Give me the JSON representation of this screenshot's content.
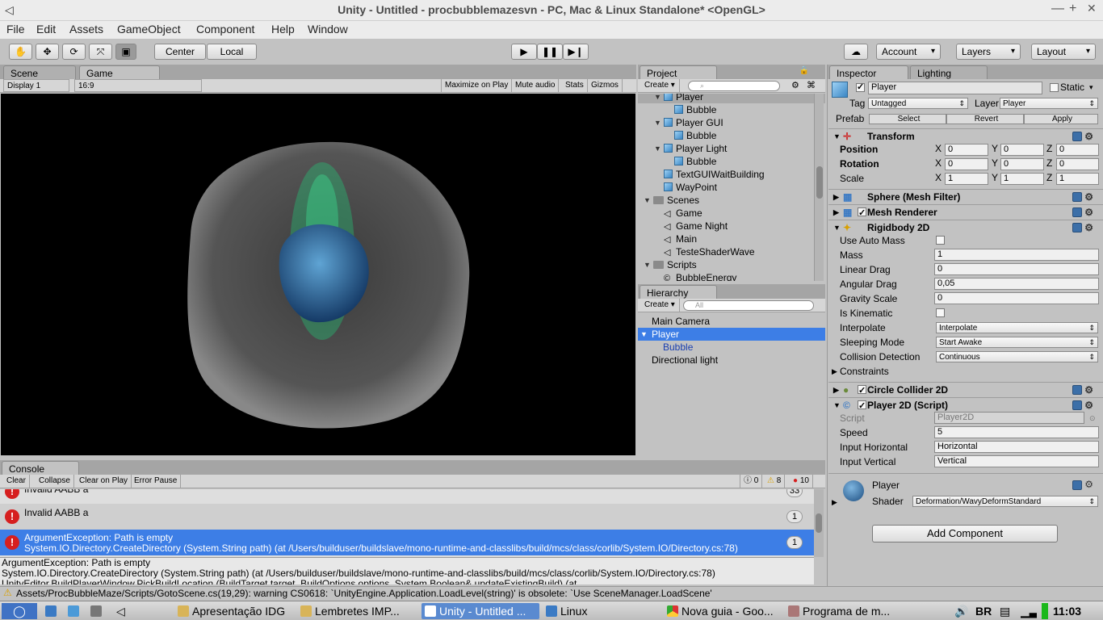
{
  "window": {
    "title": "Unity - Untitled - procbubblemazesvn - PC, Mac & Linux Standalone* <OpenGL>",
    "minimize": "—",
    "maximize": "+",
    "close": "✕"
  },
  "menu": [
    "File",
    "Edit",
    "Assets",
    "GameObject",
    "Component",
    "Help",
    "Window"
  ],
  "toolbar": {
    "pivot": "Center",
    "space": "Local",
    "account": "Account",
    "layers": "Layers",
    "layout": "Layout"
  },
  "scene_tabs": {
    "scene": "Scene",
    "game": "Game",
    "display": "Display 1",
    "aspect": "16:9",
    "maximize": "Maximize on Play",
    "mute": "Mute audio",
    "stats": "Stats",
    "gizmos": "Gizmos"
  },
  "project": {
    "tab": "Project",
    "create": "Create",
    "items": [
      {
        "label": "Player",
        "icon": "cube",
        "depth": 2,
        "expanded": true,
        "selected": true
      },
      {
        "label": "Bubble",
        "icon": "cube",
        "depth": 3
      },
      {
        "label": "Player GUI",
        "icon": "cube",
        "depth": 2,
        "expanded": true
      },
      {
        "label": "Bubble",
        "icon": "cube",
        "depth": 3
      },
      {
        "label": "Player Light",
        "icon": "cube",
        "depth": 2,
        "expanded": true
      },
      {
        "label": "Bubble",
        "icon": "cube",
        "depth": 3
      },
      {
        "label": "TextGUIWaitBuilding",
        "icon": "cube",
        "depth": 2
      },
      {
        "label": "WayPoint",
        "icon": "cube",
        "depth": 2
      },
      {
        "label": "Scenes",
        "icon": "folder",
        "depth": 1,
        "expanded": true
      },
      {
        "label": "Game",
        "icon": "unity",
        "depth": 2
      },
      {
        "label": "Game Night",
        "icon": "unity",
        "depth": 2
      },
      {
        "label": "Main",
        "icon": "unity",
        "depth": 2
      },
      {
        "label": "TesteShaderWave",
        "icon": "unity",
        "depth": 2
      },
      {
        "label": "Scripts",
        "icon": "folder",
        "depth": 1,
        "expanded": true
      },
      {
        "label": "BubbleEnergy",
        "icon": "script",
        "depth": 2
      }
    ]
  },
  "hierarchy": {
    "tab": "Hierarchy",
    "create": "Create",
    "search": "All",
    "items": [
      {
        "label": "Main Camera",
        "depth": 0
      },
      {
        "label": "Player",
        "depth": 0,
        "selected": true,
        "expanded": true
      },
      {
        "label": "Bubble",
        "depth": 1
      },
      {
        "label": "Directional light",
        "depth": 0
      }
    ]
  },
  "inspector": {
    "tab": "Inspector",
    "lighting": "Lighting",
    "name": "Player",
    "static": "Static",
    "tag_label": "Tag",
    "tag": "Untagged",
    "layer_label": "Layer",
    "layer": "Player",
    "prefab": "Prefab",
    "select": "Select",
    "revert": "Revert",
    "apply": "Apply",
    "transform": {
      "title": "Transform",
      "position": "Position",
      "rotation": "Rotation",
      "scale": "Scale",
      "pos": [
        "0",
        "0",
        "0"
      ],
      "rot": [
        "0",
        "0",
        "0"
      ],
      "scl": [
        "1",
        "1",
        "1"
      ]
    },
    "mesh_filter": "Sphere (Mesh Filter)",
    "mesh_renderer": "Mesh Renderer",
    "rigidbody": {
      "title": "Rigidbody 2D",
      "use_auto_mass": "Use Auto Mass",
      "mass_label": "Mass",
      "mass": "1",
      "linear_drag_label": "Linear Drag",
      "linear_drag": "0",
      "angular_drag_label": "Angular Drag",
      "angular_drag": "0,05",
      "gravity_label": "Gravity Scale",
      "gravity": "0",
      "kinematic": "Is Kinematic",
      "interpolate_label": "Interpolate",
      "interpolate": "Interpolate",
      "sleeping_label": "Sleeping Mode",
      "sleeping": "Start Awake",
      "collision_label": "Collision Detection",
      "collision": "Continuous",
      "constraints": "Constraints"
    },
    "circle": "Circle Collider 2D",
    "script": {
      "title": "Player 2D (Script)",
      "script_label": "Script",
      "script": "Player2D",
      "speed_label": "Speed",
      "speed": "5",
      "h_label": "Input Horizontal",
      "h": "Horizontal",
      "v_label": "Input Vertical",
      "v": "Vertical"
    },
    "material": {
      "name": "Player",
      "shader_label": "Shader",
      "shader": "Deformation/WavyDeformStandard"
    },
    "add_component": "Add Component"
  },
  "console": {
    "tab": "Console",
    "clear": "Clear",
    "collapse": "Collapse",
    "clear_on_play": "Clear on Play",
    "error_pause": "Error Pause",
    "logs": "0",
    "warnings": "8",
    "errors": "10",
    "entries": [
      {
        "text": "Invalid AABB a",
        "count": "33",
        "partial": true
      },
      {
        "text": "Invalid AABB a",
        "count": "1"
      },
      {
        "text": "ArgumentException: Path is empty",
        "text2": "System.IO.Directory.CreateDirectory (System.String path) (at /Users/builduser/buildslave/mono-runtime-and-classlibs/build/mcs/class/corlib/System.IO/Directory.cs:78)",
        "count": "1",
        "selected": true
      }
    ],
    "detail": [
      "ArgumentException: Path is empty",
      "System.IO.Directory.CreateDirectory (System.String path) (at /Users/builduser/buildslave/mono-runtime-and-classlibs/build/mcs/class/corlib/System.IO/Directory.cs:78)",
      "UnityEditor.BuildPlayerWindow.PickBuildLocation (BuildTarget target, BuildOptions options, System.Boolean& updateExistingBuild) (at"
    ]
  },
  "statusbar": "Assets/ProcBubbleMaze/Scripts/GotoScene.cs(19,29): warning CS0618: `UnityEngine.Application.LoadLevel(string)' is obsolete: `Use SceneManager.LoadScene'",
  "taskbar": {
    "items": [
      "Apresentação IDG",
      "Lembretes IMP...",
      "Unity - Untitled ...",
      "Linux",
      "Nova guia - Goo...",
      "Programa de m..."
    ],
    "lang": "BR",
    "clock": "11:03"
  }
}
